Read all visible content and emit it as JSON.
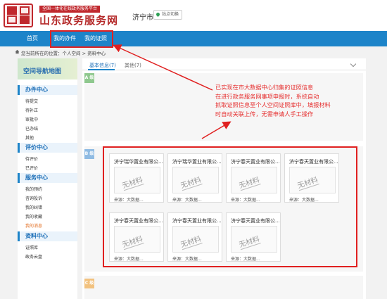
{
  "header": {
    "tagline": "全国一体化在线政务服务平台",
    "site_title": "山东政务服务网",
    "city": "济宁市",
    "switch_label": "站点切换"
  },
  "nav": [
    "首页",
    "我的办件",
    "我的证照"
  ],
  "breadcrumb": "您当前所在的位置：个人空间 > 资料中心",
  "sidebar": {
    "banner": "空间导航地图",
    "sections": [
      {
        "title": "办件中心",
        "items": [
          "待提交",
          "待补正",
          "审批中",
          "已办结",
          "其他"
        ]
      },
      {
        "title": "评价中心",
        "items": [
          "待评价",
          "已评价"
        ]
      },
      {
        "title": "服务中心",
        "items": [
          "我的预约",
          "咨询投诉",
          "我的纠错",
          "我的收藏",
          "我的消息"
        ]
      },
      {
        "title": "资料中心",
        "items": [
          "证照库",
          "政务云盘"
        ]
      }
    ],
    "active_item": "我的消息"
  },
  "tabs": [
    "基本信息(7)",
    "其他(7)"
  ],
  "levels": [
    "A 级",
    "B 级",
    "C 级"
  ],
  "cards": [
    {
      "name": "济宁瑞华置业有限公...",
      "watermark": "无材料",
      "source": "来源：大数据..."
    },
    {
      "name": "济宁瑞华置业有限公...",
      "watermark": "无材料",
      "source": "来源：大数据..."
    },
    {
      "name": "济宁春天置业有限公...",
      "watermark": "无材料",
      "source": "来源：大数据..."
    },
    {
      "name": "济宁春天置业有限公...",
      "watermark": "无材料",
      "source": "来源：大数据..."
    },
    {
      "name": "济宁春天置业有限公...",
      "watermark": "无材料",
      "source": "来源：大数据..."
    },
    {
      "name": "济宁春天置业有限公...",
      "watermark": "无材料",
      "source": "来源：大数据..."
    },
    {
      "name": "济宁春天置业有限公...",
      "watermark": "无材料",
      "source": "来源：大数据..."
    }
  ],
  "annotation": [
    "已实现在市大数据中心归集的证照信息",
    "在进行政务服务网事项申报时，系统自动",
    "抓取证照信息至个人空间证照库中，填报材料",
    "时自动关联上传，无需申请人手工操作"
  ],
  "colors": {
    "nav": "#1d84c9",
    "brand_red": "#c0282d",
    "annotation_red": "#e02020"
  }
}
